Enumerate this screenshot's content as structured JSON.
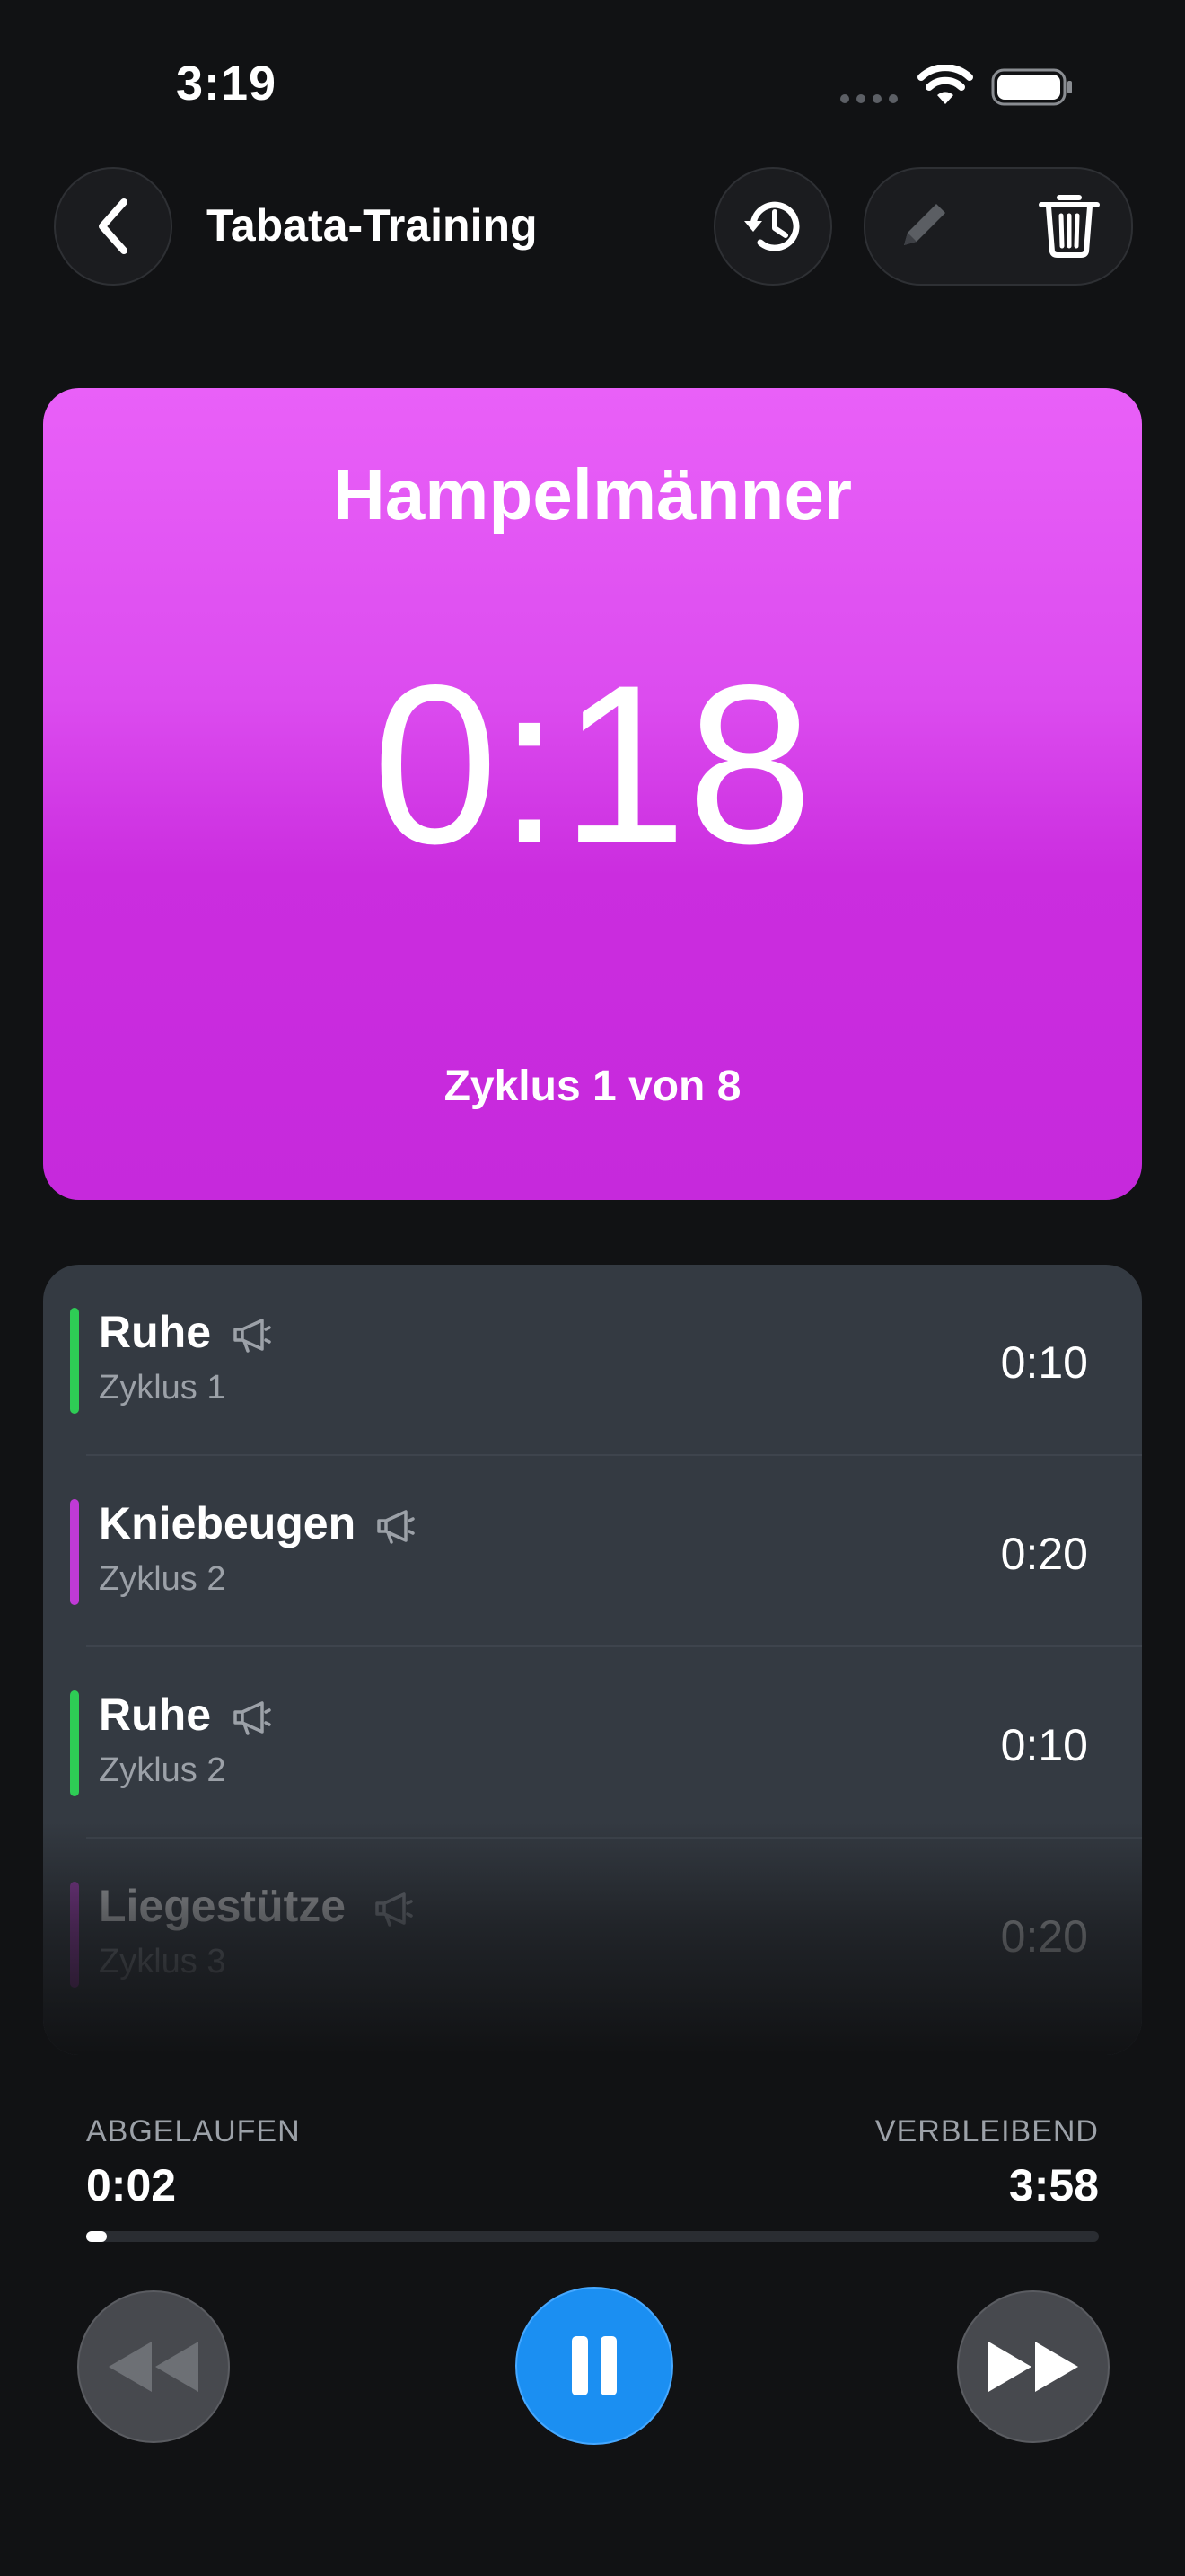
{
  "status_bar": {
    "time": "3:19",
    "battery_level": 1.0
  },
  "header": {
    "title": "Tabata-Training",
    "back_icon": "chevron-left-icon",
    "history_icon": "history-icon",
    "edit_icon": "pencil-icon",
    "delete_icon": "trash-icon"
  },
  "current": {
    "exercise": "Hampelmänner",
    "remaining": "0:18",
    "cycle_text": "Zyklus 1 von 8",
    "card_color": "#d33ee8"
  },
  "queue": [
    {
      "name": "Ruhe",
      "cycle": "Zyklus 1",
      "duration": "0:10",
      "color": "#2ecc55"
    },
    {
      "name": "Kniebeugen",
      "cycle": "Zyklus 2",
      "duration": "0:20",
      "color": "#c03ad6"
    },
    {
      "name": "Ruhe",
      "cycle": "Zyklus 2",
      "duration": "0:10",
      "color": "#2ecc55"
    },
    {
      "name": "Liegestütze",
      "cycle": "Zyklus 3",
      "duration": "0:20",
      "color": "#c03ad6"
    }
  ],
  "progress": {
    "elapsed_label": "ABGELAUFEN",
    "elapsed": "0:02",
    "remaining_label": "VERBLEIBEND",
    "remaining": "3:58",
    "fraction": 0.008
  },
  "controls": {
    "rewind_icon": "rewind-icon",
    "pause_icon": "pause-icon",
    "forward_icon": "fast-forward-icon",
    "accent": "#1b8ff2"
  }
}
